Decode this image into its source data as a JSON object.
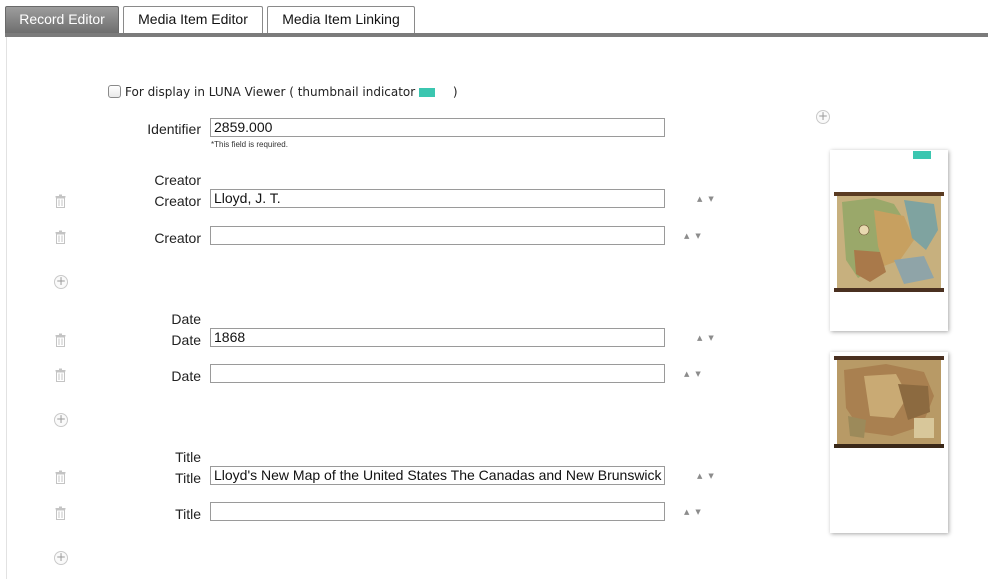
{
  "tabs": [
    {
      "label": "Record Editor",
      "active": true
    },
    {
      "label": "Media Item Editor",
      "active": false
    },
    {
      "label": "Media Item Linking",
      "active": false
    }
  ],
  "display_option": {
    "label_prefix": "For display in LUNA Viewer ( thumbnail indicator",
    "label_suffix": ")",
    "checked": false,
    "indicator_color": "#3bc6b0"
  },
  "identifier": {
    "label": "Identifier",
    "value": "2859.000",
    "required_note": "*This field is required."
  },
  "groups": [
    {
      "header": "Creator",
      "rows": [
        {
          "label": "Creator",
          "value": "Lloyd, J. T."
        },
        {
          "label": "Creator",
          "value": ""
        }
      ]
    },
    {
      "header": "Date",
      "rows": [
        {
          "label": "Date",
          "value": "1868"
        },
        {
          "label": "Date",
          "value": ""
        }
      ]
    },
    {
      "header": "Title",
      "rows": [
        {
          "label": "Title",
          "value": "Lloyd's New Map of the United States The Canadas and New Brunswick"
        },
        {
          "label": "Title",
          "value": ""
        }
      ]
    }
  ],
  "icons": {
    "add": "plus-circle-icon",
    "delete": "trash-icon",
    "move": "up-down-arrows-icon"
  },
  "media_items": [
    {
      "description": "map thumbnail",
      "has_indicator": true
    },
    {
      "description": "map thumbnail",
      "has_indicator": false
    }
  ]
}
